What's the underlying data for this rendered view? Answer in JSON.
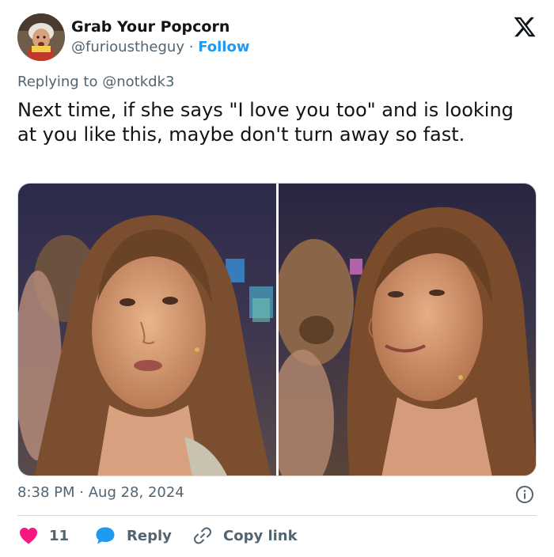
{
  "author": {
    "display_name": "Grab Your Popcorn",
    "handle": "@furioustheguy",
    "separator": "·",
    "follow_label": "Follow"
  },
  "reply": {
    "prefix": "Replying to",
    "to_handle": "@notkdk3"
  },
  "tweet": {
    "text": "Next time, if she says \"I love you too\" and is looking at you like this, maybe don't turn away so fast."
  },
  "meta": {
    "time": "8:38 PM",
    "separator": "·",
    "date": "Aug 28, 2024"
  },
  "actions": {
    "likes_count": "11",
    "reply_label": "Reply",
    "copy_link_label": "Copy link"
  },
  "colors": {
    "accent": "#1d9bf0",
    "like": "#f91880",
    "muted": "#536471",
    "text": "#0f1419"
  },
  "icons": [
    "x-logo-icon",
    "info-icon",
    "heart-icon",
    "reply-bubble-icon",
    "link-icon"
  ]
}
